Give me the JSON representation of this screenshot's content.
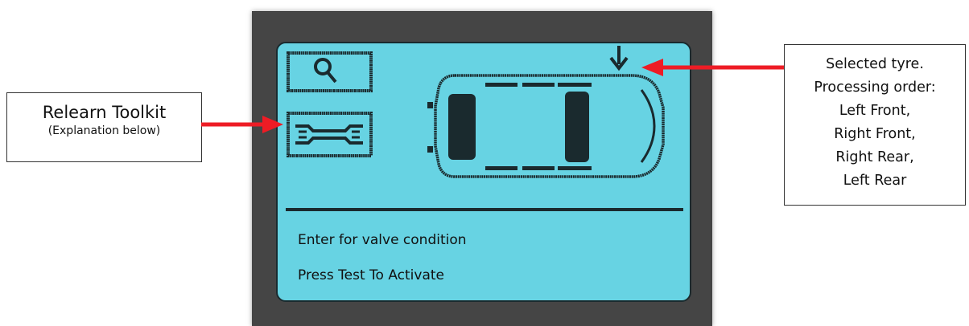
{
  "device": {
    "icons": [
      "search-icon",
      "wrench-icon"
    ],
    "status_line_1": "Enter for valve condition",
    "status_line_2": "Press Test To Activate",
    "colors": {
      "screen": "#67d3e3",
      "bezel": "#454545",
      "pixel": "#1a2a2e"
    }
  },
  "callouts": {
    "toolkit": {
      "title": "Relearn Toolkit",
      "subtitle": "(Explanation below)"
    },
    "selected_tyre": {
      "lines": [
        "Selected tyre.",
        "Processing order:",
        "Left Front,",
        "Right Front,",
        "Right Rear,",
        "Left Rear"
      ]
    }
  },
  "colors": {
    "arrow": "#ee1c25"
  }
}
